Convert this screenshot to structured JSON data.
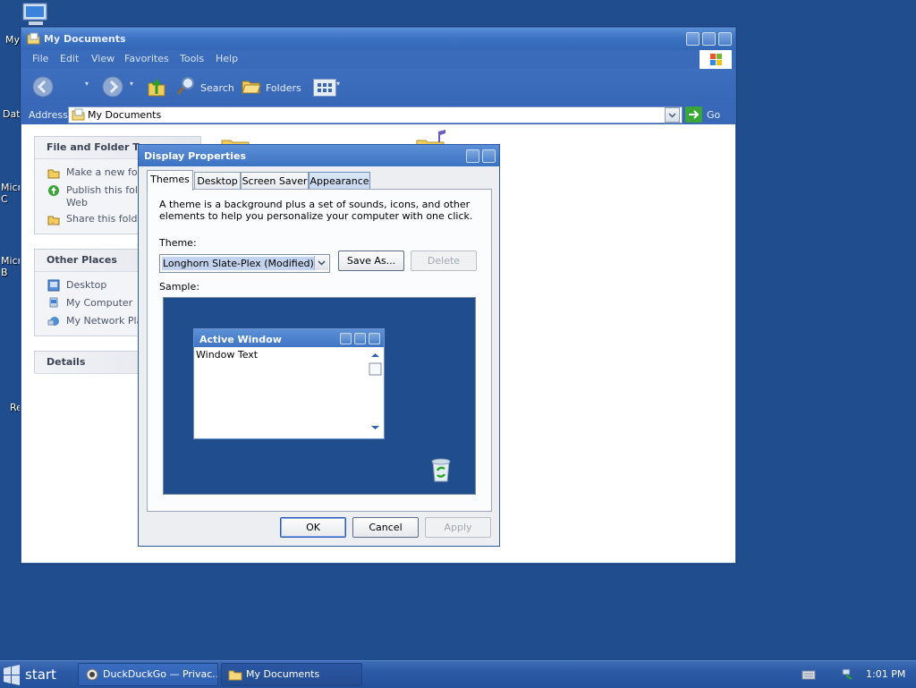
{
  "desktop": {
    "icons": [
      {
        "label": "My",
        "icon": "my-computer-icon"
      },
      {
        "label": "Dat",
        "icon": "folder-icon"
      },
      {
        "label": "Micro\nC",
        "icon": "app-icon"
      },
      {
        "label": "Micro\nB",
        "icon": "app-icon"
      },
      {
        "label": "Re",
        "icon": "recycle-bin-icon"
      }
    ]
  },
  "explorer": {
    "title": "My Documents",
    "menu": [
      "File",
      "Edit",
      "View",
      "Favorites",
      "Tools",
      "Help"
    ],
    "toolbar": {
      "search": "Search",
      "folders": "Folders"
    },
    "address": {
      "label": "Address",
      "value": "My Documents",
      "go": "Go"
    },
    "file_tasks": {
      "header": "File and Folder Tas",
      "items": [
        "Make a new fold",
        "Publish this folde",
        "Web",
        "Share this folder"
      ]
    },
    "other_places": {
      "header": "Other Places",
      "items": [
        "Desktop",
        "My Computer",
        "My Network Plac"
      ]
    },
    "details": {
      "header": "Details"
    }
  },
  "dialog": {
    "title": "Display Properties",
    "tabs": [
      "Themes",
      "Desktop",
      "Screen Saver",
      "Appearance"
    ],
    "description": "A theme is a background plus a set of sounds, icons, and other elements to help you personalize your computer with one click.",
    "theme_label": "Theme:",
    "theme_value": "Longhorn Slate-Plex (Modified)",
    "save_as": "Save As...",
    "delete": "Delete",
    "sample_label": "Sample:",
    "sample_window": {
      "title": "Active Window",
      "text": "Window Text"
    },
    "ok": "OK",
    "cancel": "Cancel",
    "apply": "Apply"
  },
  "taskbar": {
    "start": "start",
    "tasks": [
      "DuckDuckGo — Privac...",
      "My Documents"
    ],
    "clock": "1:01 PM"
  },
  "colors": {
    "desktop": "#1f4d8e",
    "title_blue": "#3d73c4"
  }
}
